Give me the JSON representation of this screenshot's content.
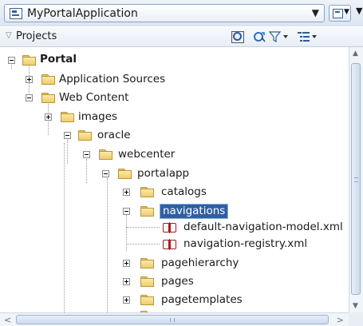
{
  "app_selector": {
    "value": "MyPortalApplication",
    "icon": "application-icon"
  },
  "toolbar": {
    "app_menu_icon": "application-menu-icon"
  },
  "projects_panel": {
    "title": "Projects",
    "toolbar_icons": [
      "find-icon",
      "sync-icon",
      "filter-icon",
      "layout-icon"
    ]
  },
  "tree": {
    "portal": "Portal",
    "application_sources": "Application Sources",
    "web_content": "Web Content",
    "images": "images",
    "oracle": "oracle",
    "webcenter": "webcenter",
    "portalapp": "portalapp",
    "catalogs": "catalogs",
    "navigations": "navigations",
    "default_navigation_model": "default-navigation-model.xml",
    "navigation_registry": "navigation-registry.xml",
    "pagehierarchy": "pagehierarchy",
    "pages": "pages",
    "pagetemplates": "pagetemplates"
  },
  "selected_node": "navigations"
}
